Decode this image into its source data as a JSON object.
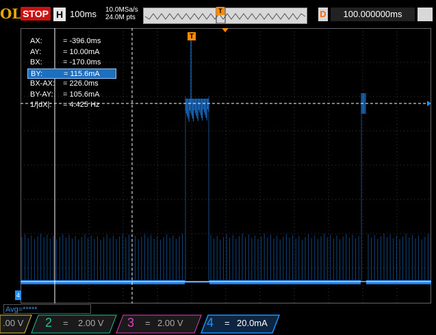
{
  "topbar": {
    "logo_text": "OL",
    "run_state": "STOP",
    "horizontal_badge": "H",
    "timebase": "100ms",
    "sample_rate": "10.0MSa/s",
    "memory_depth": "24.0M pts",
    "trigger_marker": "T",
    "delay_badge": "D",
    "delay_value": "100.000000ms"
  },
  "measurements": [
    {
      "key": "AX:",
      "value": "=  -396.0ms"
    },
    {
      "key": "AY:",
      "value": "=  10.00mA"
    },
    {
      "key": "BX:",
      "value": "=  -170.0ms"
    },
    {
      "key": "BY:",
      "value": "=  115.6mA",
      "selected": true
    },
    {
      "key": "BX-AX:",
      "value": "=  226.0ms"
    },
    {
      "key": "BY-AY:",
      "value": "=  105.6mA"
    },
    {
      "key": "1/|dX|:",
      "value": "=  4.425 Hz"
    }
  ],
  "screen": {
    "trigger_label": "T",
    "channel4_marker": "4"
  },
  "bottom": {
    "acquire_mode": "Avg=*****",
    "channels": [
      {
        "number": "",
        "scale": ".00 V",
        "color": "#e6c84a"
      },
      {
        "number": "2",
        "coupling": "=",
        "scale": "2.00 V",
        "color": "#24c0a0"
      },
      {
        "number": "3",
        "coupling": "=",
        "scale": "2.00 V",
        "color": "#e040c0"
      },
      {
        "number": "4",
        "coupling": "=",
        "scale": "20.0mA",
        "color": "#1e90ff"
      }
    ]
  },
  "colors": {
    "trace": "#1e7fe8",
    "stop": "#cc1111",
    "trigger": "#ff8c00",
    "cursor": "#ffffff"
  }
}
